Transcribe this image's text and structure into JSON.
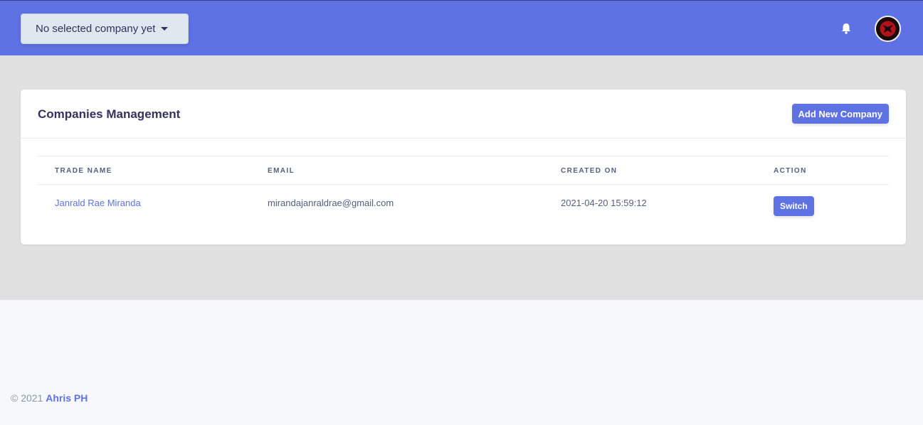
{
  "header": {
    "company_select_label": "No selected company yet",
    "accent_color": "#5e72e4",
    "bell_icon": "bell-icon",
    "avatar_icon": "user-avatar"
  },
  "card": {
    "title": "Companies Management",
    "add_button_label": "Add New Company"
  },
  "table": {
    "columns": [
      "TRADE NAME",
      "EMAIL",
      "CREATED ON",
      "ACTION"
    ],
    "rows": [
      {
        "trade_name": "Janrald Rae Miranda",
        "email": "mirandajanraldrae@gmail.com",
        "created_on": "2021-04-20 15:59:12",
        "action_label": "Switch"
      }
    ]
  },
  "footer": {
    "copyright": "© 2021",
    "brand": "Ahris PH"
  }
}
